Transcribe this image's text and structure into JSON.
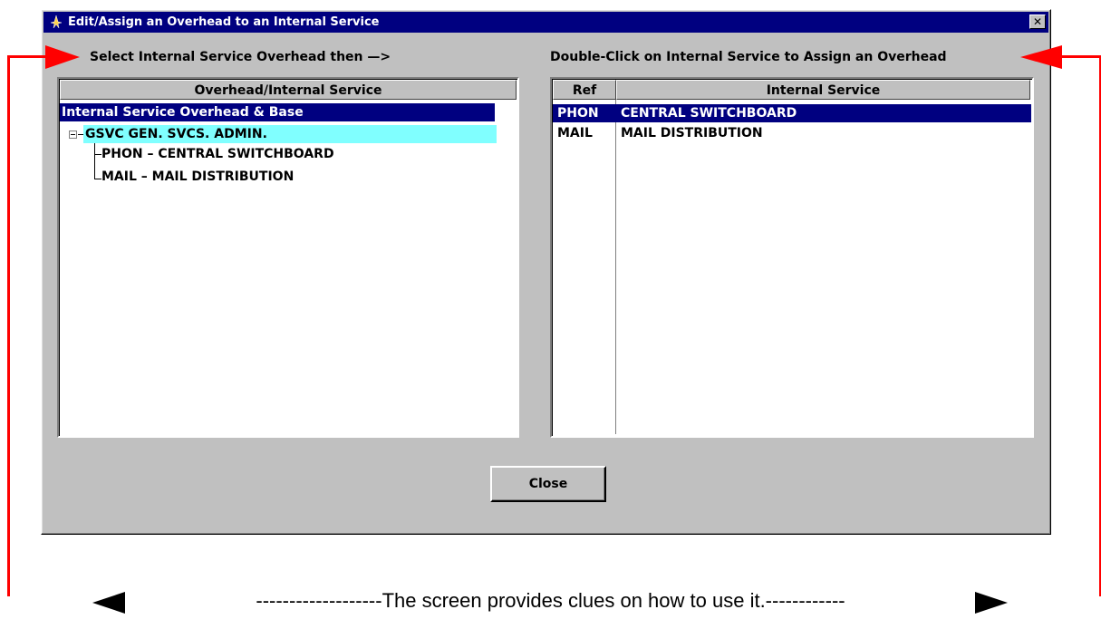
{
  "window": {
    "title": "Edit/Assign an Overhead to an Internal Service",
    "icon": "app-icon",
    "close_glyph": "✕"
  },
  "hints": {
    "left": "Select Internal Service Overhead then —>",
    "right": "Double-Click on Internal Service to Assign an Overhead"
  },
  "tree": {
    "header": "Overhead/Internal Service",
    "items": [
      {
        "label": "Internal Service Overhead & Base",
        "state": "selected"
      },
      {
        "label": "GSVC    GEN. SVCS. ADMIN.",
        "state": "highlighted",
        "expander": "minus"
      },
      {
        "label": "PHON  –  CENTRAL SWITCHBOARD"
      },
      {
        "label": "MAIL  –  MAIL DISTRIBUTION"
      }
    ]
  },
  "services": {
    "headers": [
      "Ref",
      "Internal Service"
    ],
    "rows": [
      {
        "ref": "PHON",
        "name": "CENTRAL SWITCHBOARD",
        "state": "selected"
      },
      {
        "ref": "MAIL",
        "name": "MAIL DISTRIBUTION"
      }
    ]
  },
  "buttons": {
    "close": "Close"
  },
  "annotation": {
    "caption": "-------------------The screen provides clues on how to use it.------------",
    "color": "#ff0000"
  },
  "colors": {
    "titlebar": "#000080",
    "window_face": "#c0c0c0",
    "selection": "#000080",
    "highlight": "#80ffff"
  }
}
